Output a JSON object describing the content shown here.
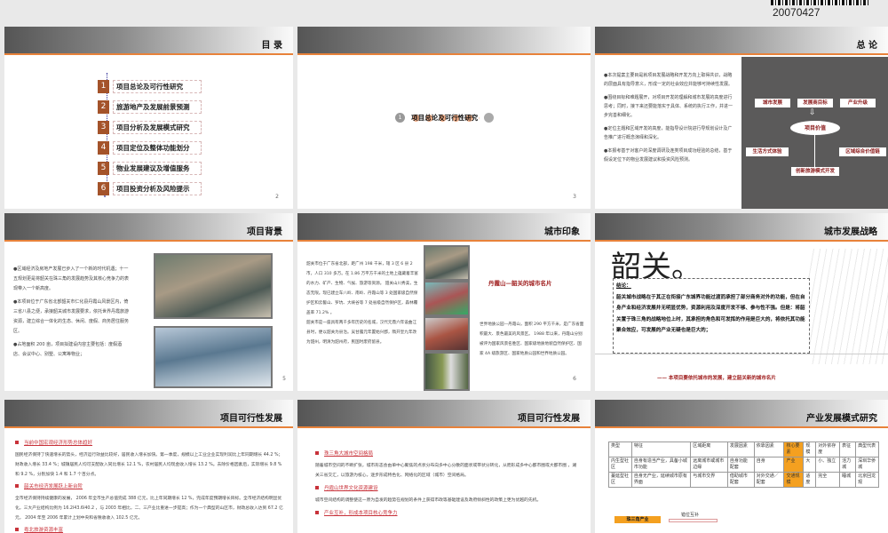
{
  "stamp": {
    "date": "20070427"
  },
  "slides": [
    {
      "title": "目 录",
      "page": "2",
      "items": [
        {
          "num": "1",
          "label": "项目总论及可行性研究"
        },
        {
          "num": "2",
          "label": "旅游地产及发展前景预测"
        },
        {
          "num": "3",
          "label": "项目分析及发展模式研究"
        },
        {
          "num": "4",
          "label": "项目定位及整体功能划分"
        },
        {
          "num": "5",
          "label": "物业发展建议及增值服务"
        },
        {
          "num": "6",
          "label": "项目投资分析及风险提示"
        }
      ]
    },
    {
      "page": "3",
      "num": "1",
      "section": "项目总论及可行性研究"
    },
    {
      "title": "总 论",
      "bullets": [
        "●本次提案主要目是就项目发展战略和开发方向上取得共识，战略的层面具有指导意义，形成一定的社会效应并能够可持续性发展。",
        "●围绕目标和难题展开，对项目开发的理解和城市发展的高度进行思考；同时，接下来还要能落实于具体、系统的执行工作，并进一步完善和细化。",
        "●定位主题和区域开发的高度，能指导设计院进行导规划设计及广告推广进行概念演绎和深化。",
        "●本报考基于对客户的深度调研及连类项目成功经验的总结，基于假设定位下的物业发展建议和投资风险预测。"
      ],
      "diagram": {
        "top": [
          "城市发展",
          "发展商目标",
          "产业升级"
        ],
        "center": "项目价值",
        "left": "生活方式体验",
        "right": "区域综合价值链",
        "bottom": "创新旅游模式开发"
      }
    },
    {
      "title": "项目背景",
      "page": "5",
      "bullets": [
        "●区域经济及房地产发展已步入了一个新的时代机遇；十一五规划更是将韶关在珠三角的发展趋势及其核心竞争力的表现带入一个新高度。",
        "●本项目位于广东省北部韶关市仁化县丹霞山风景区内，倚三省八县之便，承接韶关城市发展要求，依托世界丹霞旅游资源，建立综合一体化的生态、休闲、度假、商务居住服务区。",
        "●占地面积 200 亩，项目拟建设内容主要包括：度假酒店、会议中心、别墅、公寓等物业；"
      ]
    },
    {
      "title": "城市印象",
      "page": "6",
      "left_text": "韶关市位于广东省北部，距广州 198 千米，辖 3 区 6 县 2 市，人口 310 多万。在 1.86 万平方千米的土地上蕴藏着丰富的水力、矿产、生物、气候、旅游等资源。 韶关山川秀美，生态无限。现已建立车八岭、南岭、丹霞山等 3 处国家级自然保护区和云髻山、罗坑、大峡谷等 7 处省级自然保护区，森林覆盖率 71.2% 。",
      "left_text2": "韶关市是一座具有两千多年历史的名城，汉代元鼎六年设曲江县时，便以韶关为县治。吴甘露元年置始兴郡，隋开皇九年改为韶州，明清为韶州府，民国时废府留县。",
      "heading": "丹霞山—韶关的城市名片",
      "right_text": "世界地质公园—丹霞山，面积 290 平方千米，是广东省面积最大、景色最美的风景区。 1988 年以来，丹霞山分别被评为国家风景名胜区、国家级地质地貌自然保护区、国家 4A 级旅游区、国家地质公园和世界地质公园。"
    },
    {
      "title": "城市发展战略",
      "big": "韶关。",
      "label": "结论：",
      "body": "韶关城市战略在于其正在衔接广东城界功能过渡而承担了部分商务对外的功能，但在自身产业和经济发展并无明显优势，资源利用及深度开发不够、参与性不强。但是：将韶关置于珠三角的战略地位上时，其承担的角色和可发挥的作用是巨大的，将依托其功能聚合效应，可发展的产业无疑也是巨大的；",
      "caption": "—— 本项目要依托城市的发展，建立韶关新的城市名片"
    },
    {
      "title": "项目可行性发展",
      "sections": [
        {
          "h": "当前中国宏观经济形势总体趋好",
          "p": "国民经济保持了快速增长的势头，经济运行效益比较好，居民收入增长加快。第一季度，规模以上工业企业实现利润比上年同期增长 44.2 %；财政收入增长 33.4 %；城镇居民人均可支配收入同比增长 12.1 %，农村居民人均现金收入增长 13.2 %。去除价格因素后，实际增长 9.8 %和 9.2 %，分别加快 1.4 和 1.7 个百分点。"
        },
        {
          "h": "韶关市经济发展跃上新台阶",
          "p": "全市经济保持持续健康的发展， 2006 年全市生产总值完成 388 亿元，比上年同期增长 12 %，完成年度预期增长目标。全市经济结构明显优化，三大产业结构比例为 16.2l43.6l40.2 ，与 2003 年相比，二、三产业比重进一步提高；作为一个典型的山区市，财政总收入达到 67.2 亿元， 2004 年至 2006 年累计上划中央和省税收收入 102.5 亿元。"
        },
        {
          "h": "粤北旅游资源丰富",
          "p": ""
        }
      ]
    },
    {
      "title": "项目可行性发展",
      "sections": [
        {
          "h": "珠三角大城市空间格局",
          "p": "随着城市空间的不断扩张，城市形态会由单中心聚焦的点状分布向多中心分散的面状或带状分转化，从而形成多中心都市圈或大都市圈 ，湖关三省交汇，以旅游为核心，逐步形成特色化、网络化的区域（城市）空间格局。"
        },
        {
          "h": "丹霞山世界文化资源建设",
          "p": "城市空间结构的调整使这一原为自发的趋势在规划的条件上获得市政等基础建设及政府倾斜性的政策上更为优越的先机。"
        },
        {
          "h": "产业互补，形成本项目核心竞争力",
          "p": ""
        }
      ]
    },
    {
      "title": "产业发展模式研究",
      "table": {
        "headers": [
          "类型",
          "特征",
          "区域距离",
          "发展因素",
          "依靠因素",
          "核心要素",
          "规模",
          "对外依存度",
          "表征",
          "典型代表"
        ],
        "rows": [
          [
            "内生型社区",
            "自身有造当产业，具备小城市功能",
            "远离城市或城市边缘",
            "自身功能配套",
            "自身",
            "产业",
            "大",
            "小、独立",
            "活力城",
            "深圳华侨城"
          ],
          [
            "蔓延型社区",
            "自身无产业，延续城市原有界面",
            "与城市交界",
            "借助城市配套",
            "对外交通／配套",
            "交通规模",
            "适度",
            "完全",
            "睡城",
            "北京回龙观"
          ]
        ]
      },
      "flow": {
        "box": "珠三角产业",
        "arrow": "错位互补"
      }
    }
  ]
}
